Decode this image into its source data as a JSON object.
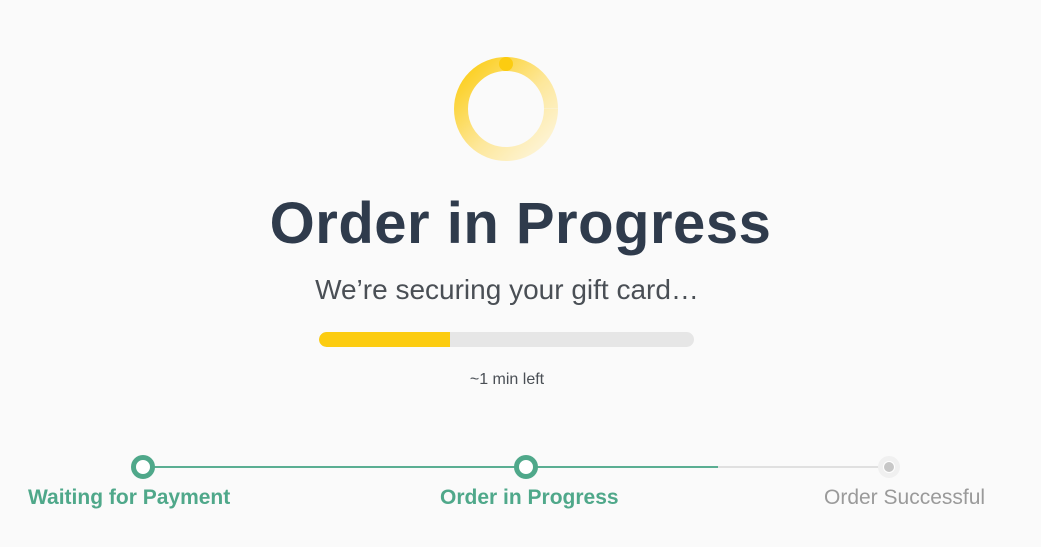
{
  "header": {
    "title": "Order in Progress",
    "subtitle": "We’re securing your gift card…"
  },
  "progress": {
    "fraction": 0.35,
    "eta_text": "~1 min left",
    "fill_color": "#fccc10",
    "track_color": "#e6e6e6"
  },
  "spinner": {
    "icon": "loading-spinner-icon",
    "color": "#fccc10"
  },
  "steps": [
    {
      "label": "Waiting for Payment",
      "state": "done"
    },
    {
      "label": "Order in Progress",
      "state": "current"
    },
    {
      "label": "Order Successful",
      "state": "pending"
    }
  ],
  "colors": {
    "title": "#2f3b4c",
    "step_done": "#4fa88a",
    "step_pending": "#9a9a9a",
    "background": "#fafafa"
  }
}
